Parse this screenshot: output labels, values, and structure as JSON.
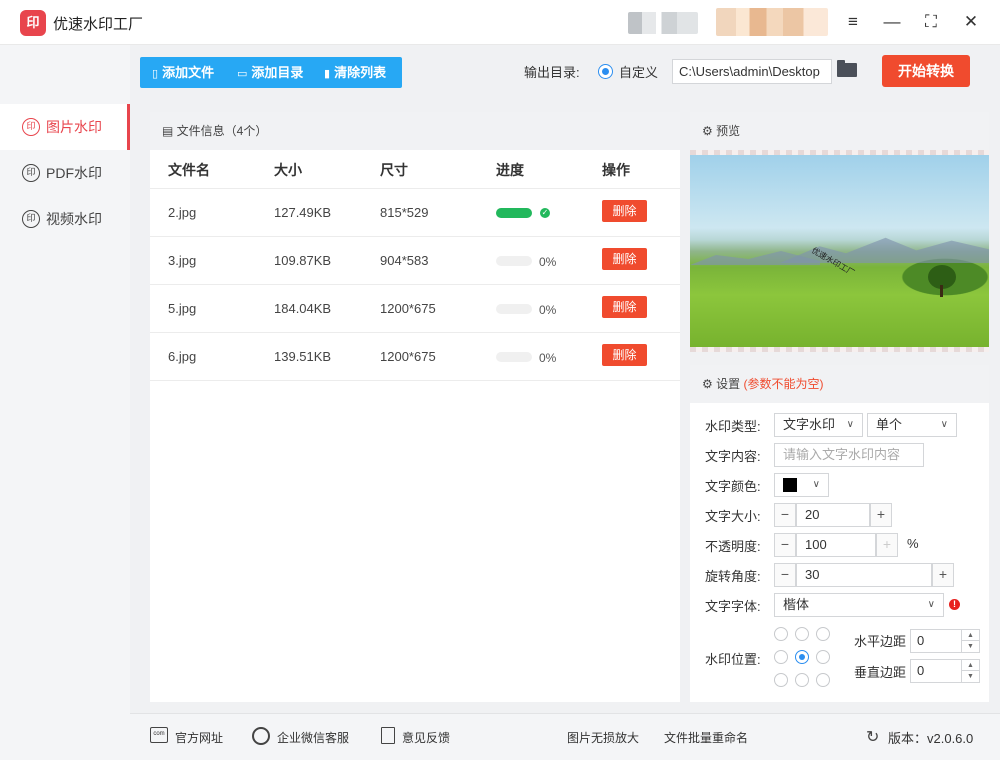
{
  "app": {
    "title": "优速水印工厂",
    "logo_text": "印"
  },
  "window_controls": {
    "menu": "≡",
    "minimize": "—",
    "maximize": "⛶",
    "close": "✕"
  },
  "sidebar": {
    "items": [
      {
        "label": "图片水印",
        "icon": "印",
        "active": true
      },
      {
        "label": "PDF水印",
        "icon": "印",
        "active": false
      },
      {
        "label": "视频水印",
        "icon": "印",
        "active": false
      }
    ]
  },
  "toolbar": {
    "add_file": "添加文件",
    "add_folder": "添加目录",
    "clear_list": "清除列表"
  },
  "output": {
    "label": "输出目录:",
    "option_custom": "自定义",
    "path": "C:\\Users\\admin\\Desktop",
    "start_button": "开始转换"
  },
  "file_panel": {
    "title": "文件信息（4个）",
    "columns": {
      "name": "文件名",
      "size": "大小",
      "dimensions": "尺寸",
      "progress": "进度",
      "action": "操作"
    },
    "rows": [
      {
        "name": "2.jpg",
        "size": "127.49KB",
        "dimensions": "815*529",
        "progress": 100,
        "progress_text": "",
        "action": "删除"
      },
      {
        "name": "3.jpg",
        "size": "109.87KB",
        "dimensions": "904*583",
        "progress": 0,
        "progress_text": "0%",
        "action": "删除"
      },
      {
        "name": "5.jpg",
        "size": "184.04KB",
        "dimensions": "1200*675",
        "progress": 0,
        "progress_text": "0%",
        "action": "删除"
      },
      {
        "name": "6.jpg",
        "size": "139.51KB",
        "dimensions": "1200*675",
        "progress": 0,
        "progress_text": "0%",
        "action": "删除"
      }
    ]
  },
  "preview": {
    "title": "预览",
    "watermark_text": "优速水印工厂"
  },
  "settings": {
    "title": "设置",
    "note": "(参数不能为空)",
    "watermark_type_label": "水印类型:",
    "watermark_type_value": "文字水印",
    "watermark_mode_value": "单个",
    "text_content_label": "文字内容:",
    "text_content_placeholder": "请输入文字水印内容",
    "text_color_label": "文字颜色:",
    "text_color_value": "#000000",
    "text_size_label": "文字大小:",
    "text_size_value": "20",
    "opacity_label": "不透明度:",
    "opacity_value": "100",
    "opacity_unit": "%",
    "rotation_label": "旋转角度:",
    "rotation_value": "30",
    "font_label": "文字字体:",
    "font_value": "楷体",
    "position_label": "水印位置:",
    "position_selected": 4,
    "h_margin_label": "水平边距",
    "h_margin_value": "0",
    "v_margin_label": "垂直边距",
    "v_margin_value": "0"
  },
  "footer": {
    "website": "官方网址",
    "wechat": "企业微信客服",
    "feedback": "意见反馈",
    "enlarge": "图片无损放大",
    "rename": "文件批量重命名",
    "version": "版本：v2.0.6.0"
  }
}
